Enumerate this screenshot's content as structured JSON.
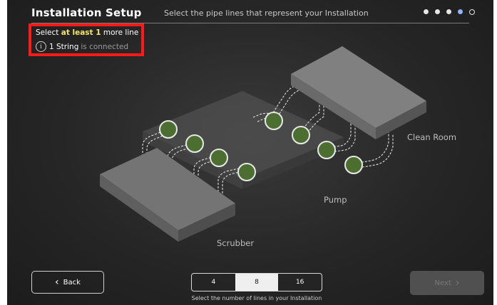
{
  "header": {
    "title": "Installation Setup",
    "subtitle": "Select the pipe lines that represent your Installation",
    "steps": [
      "done",
      "done",
      "done",
      "active",
      "todo"
    ]
  },
  "notice": {
    "prefix": "Select ",
    "highlight": "at least 1",
    "suffix": " more line",
    "status_count": "1 String",
    "status_rest": "is connected",
    "info_icon": "i"
  },
  "scene": {
    "labels": {
      "clean_room": "Clean Room",
      "pump": "Pump",
      "scrubber": "Scrubber"
    },
    "connector_count": 8
  },
  "footer": {
    "back_label": "Back",
    "back_icon": "‹",
    "line_options": [
      "4",
      "8",
      "16"
    ],
    "selected_option": "8",
    "options_caption": "Select the number of lines in your Installation",
    "next_label": "Next",
    "next_icon": "›"
  },
  "colors": {
    "highlight": "#f3e66a",
    "alert_border": "#ff1a1a",
    "connector_fill": "#4c6e30",
    "active_step": "#8fb2ff"
  }
}
